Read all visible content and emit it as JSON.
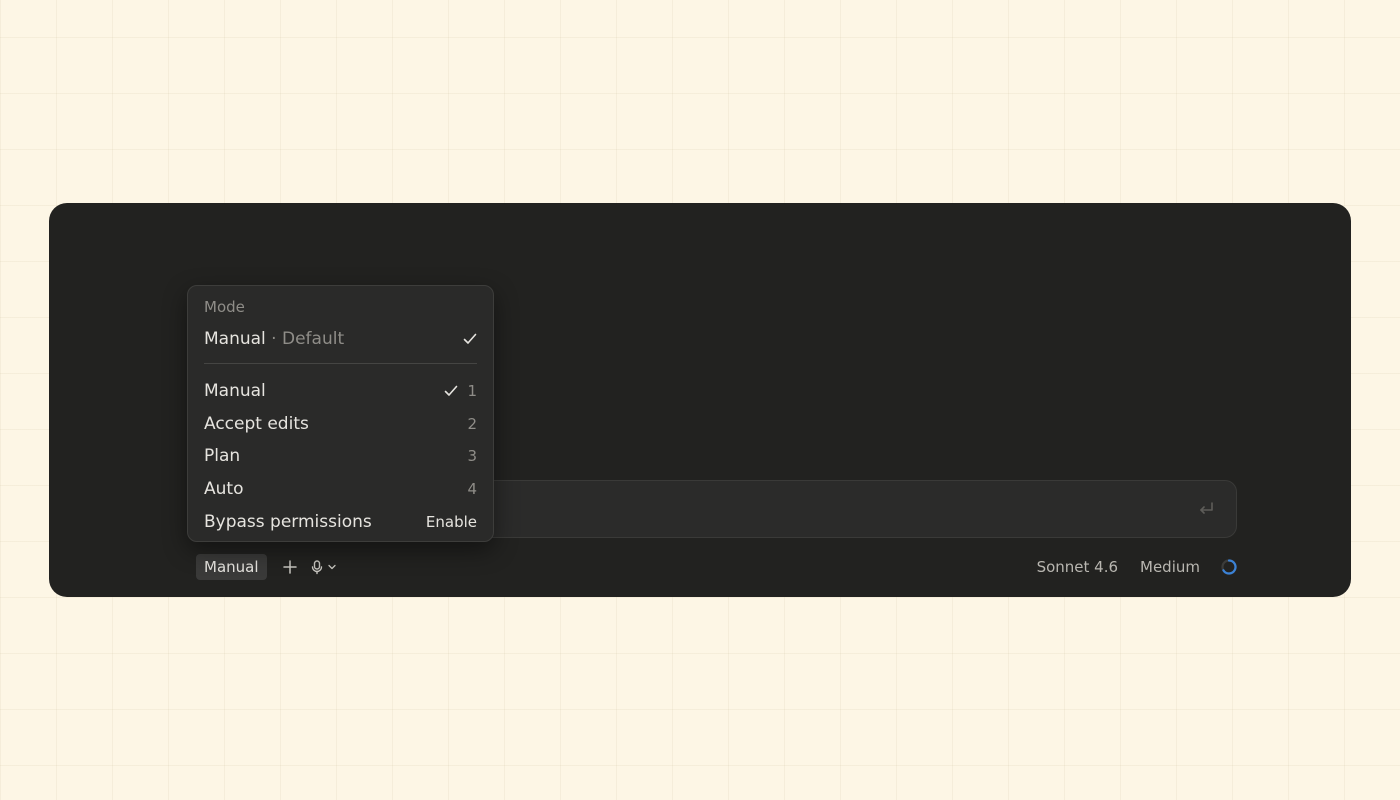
{
  "composer": {
    "mode_button_label": "Manual",
    "model_label": "Sonnet 4.6",
    "effort_label": "Medium"
  },
  "mode_menu": {
    "heading": "Mode",
    "current": {
      "name": "Manual",
      "separator": " · ",
      "default_label": "Default"
    },
    "items": [
      {
        "label": "Manual",
        "shortcut": "1",
        "checked": true
      },
      {
        "label": "Accept edits",
        "shortcut": "2",
        "checked": false
      },
      {
        "label": "Plan",
        "shortcut": "3",
        "checked": false
      },
      {
        "label": "Auto",
        "shortcut": "4",
        "checked": false
      },
      {
        "label": "Bypass permissions",
        "action": "Enable"
      }
    ]
  },
  "icons": {
    "check": "check-icon",
    "plus": "plus-icon",
    "mic": "mic-icon",
    "chevron": "chevron-down-icon",
    "submit": "enter-return-icon",
    "context": "context-usage-ring-icon"
  },
  "colors": {
    "page_background": "#fdf6e5",
    "panel_background": "#222220",
    "menu_background": "#2a2a29",
    "text_primary": "#e6e4df",
    "text_muted": "#8f8d88",
    "accent_blue": "#3b82d6"
  }
}
